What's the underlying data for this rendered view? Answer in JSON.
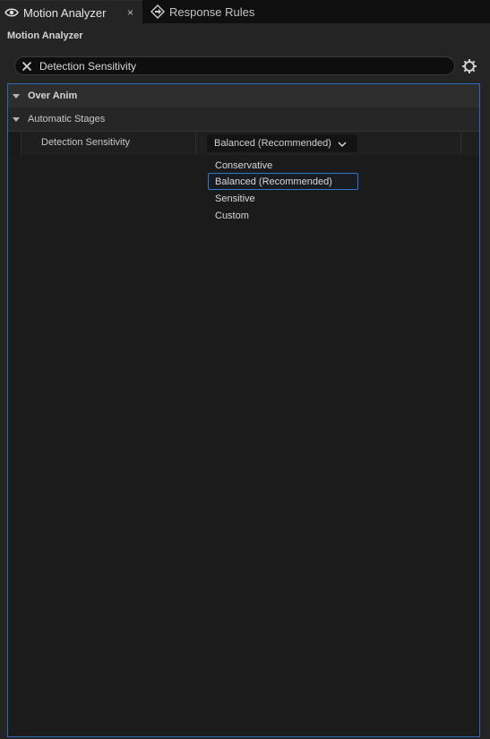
{
  "tabs": [
    {
      "label": "Motion Analyzer",
      "icon": "eye-icon",
      "active": true,
      "close": "×"
    },
    {
      "label": "Response Rules",
      "icon": "diamond-arrow-icon",
      "active": false
    }
  ],
  "panel": {
    "title": "Motion Analyzer",
    "search": {
      "value": "Detection Sensitivity",
      "clear_icon": "close-icon"
    },
    "settings_icon": "gear-icon"
  },
  "categories": [
    {
      "label": "Over Anim"
    },
    {
      "label": "Automatic Stages"
    }
  ],
  "property": {
    "name": "Detection Sensitivity",
    "value": "Balanced (Recommended)"
  },
  "dropdown": {
    "options": [
      "Conservative",
      "Balanced (Recommended)",
      "Sensitive",
      "Custom"
    ],
    "selected_index": 1
  },
  "colors": {
    "accent": "#2f78c8",
    "panel_bg": "#242424",
    "details_bg": "#1b1b1b"
  }
}
